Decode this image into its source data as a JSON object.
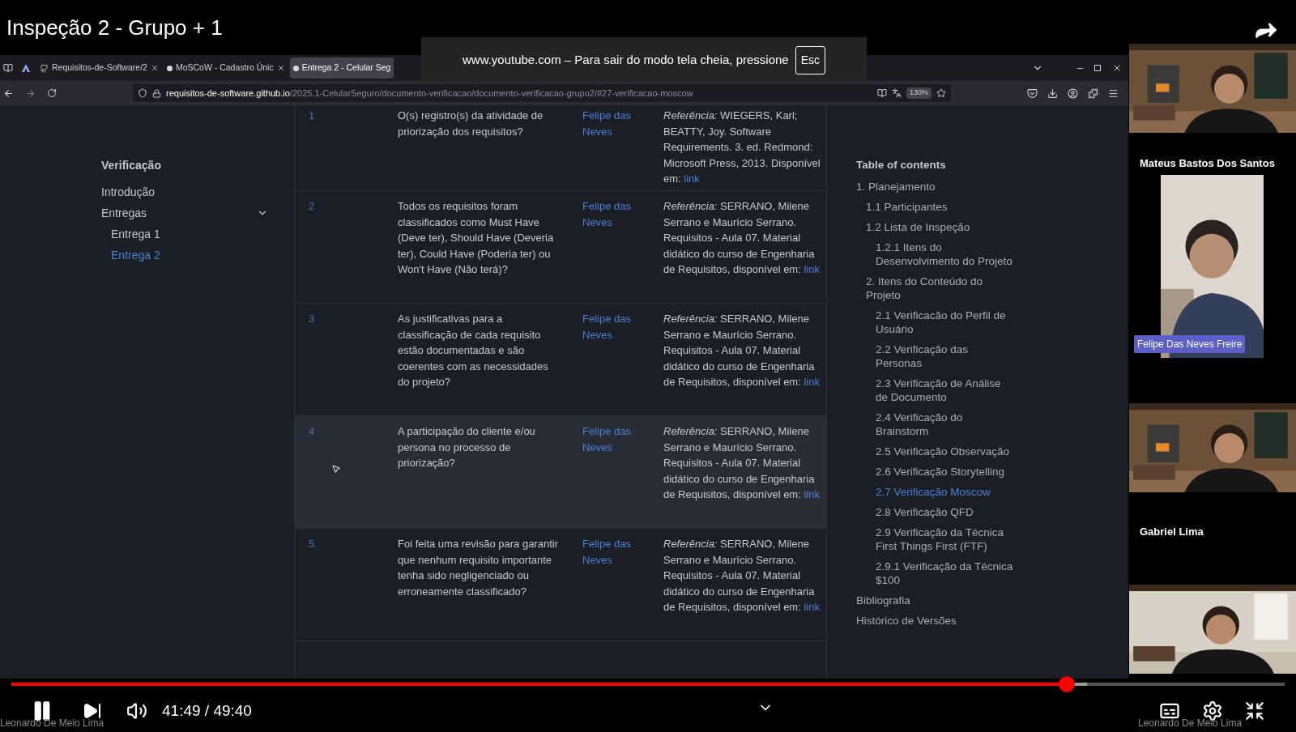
{
  "video_title": "Inspeção 2 - Grupo + 1",
  "fullscreen_notice": {
    "text": "www.youtube.com – Para sair do modo tela cheia, pressione",
    "key": "Esc"
  },
  "browser": {
    "tabs": [
      {
        "label": "Requisitos-de-Software/2",
        "selected": false
      },
      {
        "label": "MoSCoW - Cadastro Únic",
        "selected": false
      },
      {
        "label": "Entrega 2 - Celular Seg",
        "selected": true
      }
    ],
    "url_domain": "requisitos-de-software.github.io",
    "url_path": "/2025.1-CelularSeguro/documento-verificacao/documento-verificacao-grupo2/#27-verificacao-moscow",
    "zoom": "130%"
  },
  "sidebar": {
    "title": "Verificação",
    "items": [
      {
        "kind": "link",
        "label": "Introdução",
        "selected": false
      },
      {
        "kind": "group",
        "label": "Entregas",
        "selected": false,
        "expanded": true,
        "children": [
          {
            "label": "Entrega 1",
            "selected": false
          },
          {
            "label": "Entrega 2",
            "selected": true
          }
        ]
      }
    ]
  },
  "table": {
    "rows": [
      {
        "number": "1",
        "question": "O(s) registro(s) da atividade de priorização dos requisitos?",
        "responsible": "Felipe das Neves",
        "reference": "*Referência:* WIEGERS, Karl; BEATTY, Joy. Software Requirements. 3. ed. Redmond: Microsoft Press, 2013. Disponível em:",
        "link": "link",
        "hovered": false
      },
      {
        "number": "2",
        "question": "Todos os requisitos foram classificados como Must Have (Deve ter), Should Have (Deveria ter), Could Have (Poderia ter) ou Won't Have (Não terá)?",
        "responsible": "Felipe das Neves",
        "reference": "*Referência:* SERRANO, Milene Serrano e Maurício Serrano. Requisitos - Aula 07. Material didático do curso de Engenharia de Requisitos, disponível em:",
        "link": "link",
        "hovered": false
      },
      {
        "number": "3",
        "question": "As justificativas para a classificação de cada requisito estão documentadas e são coerentes com as necessidades do projeto?",
        "responsible": "Felipe das Neves",
        "reference": "*Referência:* SERRANO, Milene Serrano e Maurício Serrano. Requisitos - Aula 07. Material didático do curso de Engenharia de Requisitos, disponível em:",
        "link": "link",
        "hovered": false
      },
      {
        "number": "4",
        "question": "A participação do cliente e/ou persona no processo de priorização?",
        "responsible": "Felipe das Neves",
        "reference": "*Referência:* SERRANO, Milene Serrano e Maurício Serrano. Requisitos - Aula 07. Material didático do curso de Engenharia de Requisitos, disponível em:",
        "link": "link",
        "hovered": true
      },
      {
        "number": "5",
        "question": "Foi feita uma revisão para garantir que nenhum requisito importante tenha sido negligenciado ou erroneamente classificado?",
        "responsible": "Felipe das Neves",
        "reference": "*Referência:* SERRANO, Milene Serrano e Maurício Serrano. Requisitos - Aula 07. Material didático do curso de Engenharia de Requisitos, disponível em:",
        "link": "link",
        "hovered": false
      }
    ]
  },
  "toc": {
    "title": "Table of contents",
    "items": [
      {
        "label": "1. Planejamento",
        "selected": false,
        "children": [
          {
            "label": "1.1 Participantes",
            "selected": false
          },
          {
            "label": "1.2 Lista de Inspeção",
            "selected": false,
            "children": [
              {
                "label": "1.2.1 Itens do Desenvolvimento do Projeto",
                "selected": false
              }
            ]
          },
          {
            "label": "2. Itens do Conteúdo do Projeto",
            "selected": false,
            "children": [
              {
                "label": "2.1 Verificacão do Perfil de Usuário",
                "selected": false
              },
              {
                "label": "2.2 Verificação das Personas",
                "selected": false
              },
              {
                "label": "2.3 Verificação de Análise de Documento",
                "selected": false
              },
              {
                "label": "2.4 Verificação do Brainstorm",
                "selected": false
              },
              {
                "label": "2.5 Verificação Observação",
                "selected": false
              },
              {
                "label": "2.6 Verificação Storytelling",
                "selected": false
              },
              {
                "label": "2.7 Verificação Moscow",
                "selected": true
              },
              {
                "label": "2.8 Verificação QFD",
                "selected": false
              },
              {
                "label": "2.9 Verificação da Técnica First Things First (FTF)",
                "selected": false
              },
              {
                "label": "2.9.1 Verificação da Técnica $100",
                "selected": false
              }
            ]
          }
        ]
      },
      {
        "label": "Bibliografia",
        "selected": false
      },
      {
        "label": "Histórico de Versões",
        "selected": false
      }
    ]
  },
  "participants": [
    {
      "kind": "video"
    },
    {
      "kind": "label",
      "name": "Mateus Bastos Dos Santos"
    },
    {
      "kind": "speaker",
      "name": "Felipe Das Neves Freire"
    },
    {
      "kind": "video"
    },
    {
      "kind": "label",
      "name": "Gabriel Lima"
    },
    {
      "kind": "video"
    }
  ],
  "player": {
    "progress": {
      "level": 0.829
    },
    "buffer": {
      "level": 0.845
    },
    "time": "41:49 / 49:40",
    "overlay_names": [
      "Leonardo De Melo Lima",
      "Leonardo De Melo Lima"
    ]
  }
}
